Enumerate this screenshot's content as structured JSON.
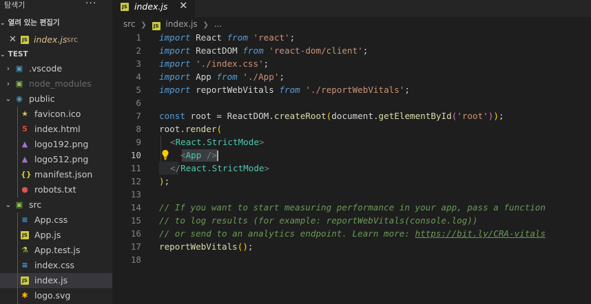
{
  "sidebar": {
    "title": "탐색기",
    "more": "···",
    "open_editors_label": "열려 있는 편집기",
    "open_editor": {
      "name": "index.js",
      "folder": "src"
    },
    "project_label": "TEST",
    "tree": [
      {
        "name": ".vscode",
        "type": "folder",
        "depth": 0,
        "state": "collapsed",
        "icon": "vscode-folder-icon",
        "color": "#519aba"
      },
      {
        "name": "node_modules",
        "type": "folder",
        "depth": 0,
        "state": "collapsed",
        "icon": "node-folder-icon",
        "color": "#8bc34a",
        "dimmed": true
      },
      {
        "name": "public",
        "type": "folder",
        "depth": 0,
        "state": "expanded",
        "icon": "public-folder-icon",
        "color": "#519aba"
      },
      {
        "name": "favicon.ico",
        "type": "file",
        "depth": 1,
        "icon": "star-icon",
        "color": "#cbcb41"
      },
      {
        "name": "index.html",
        "type": "file",
        "depth": 1,
        "icon": "html-icon",
        "color": "#e44d26"
      },
      {
        "name": "logo192.png",
        "type": "file",
        "depth": 1,
        "icon": "image-icon",
        "color": "#a074c4"
      },
      {
        "name": "logo512.png",
        "type": "file",
        "depth": 1,
        "icon": "image-icon",
        "color": "#a074c4"
      },
      {
        "name": "manifest.json",
        "type": "file",
        "depth": 1,
        "icon": "json-icon",
        "color": "#cbcb41"
      },
      {
        "name": "robots.txt",
        "type": "file",
        "depth": 1,
        "icon": "robot-icon",
        "color": "#e05252"
      },
      {
        "name": "src",
        "type": "folder",
        "depth": 0,
        "state": "expanded",
        "icon": "src-folder-icon",
        "color": "#8bc34a"
      },
      {
        "name": "App.css",
        "type": "file",
        "depth": 1,
        "icon": "css-icon",
        "color": "#42a5f5"
      },
      {
        "name": "App.js",
        "type": "file",
        "depth": 1,
        "icon": "js-icon",
        "color": "#cbcb41"
      },
      {
        "name": "App.test.js",
        "type": "file",
        "depth": 1,
        "icon": "test-icon",
        "color": "#cbcb41"
      },
      {
        "name": "index.css",
        "type": "file",
        "depth": 1,
        "icon": "css-icon",
        "color": "#42a5f5"
      },
      {
        "name": "index.js",
        "type": "file",
        "depth": 1,
        "icon": "js-icon",
        "color": "#cbcb41",
        "selected": true
      },
      {
        "name": "logo.svg",
        "type": "file",
        "depth": 1,
        "icon": "svg-icon",
        "color": "#ffb300"
      }
    ]
  },
  "tab": {
    "name": "index.js",
    "close": "✕"
  },
  "breadcrumb": {
    "folder": "src",
    "file": "index.js",
    "more": "..."
  },
  "editor": {
    "active_line": 10,
    "lines": [
      {
        "n": "1"
      },
      {
        "n": "2"
      },
      {
        "n": "3"
      },
      {
        "n": "4"
      },
      {
        "n": "5"
      },
      {
        "n": "6"
      },
      {
        "n": "7"
      },
      {
        "n": "8"
      },
      {
        "n": "9"
      },
      {
        "n": "10"
      },
      {
        "n": "11"
      },
      {
        "n": "12"
      },
      {
        "n": "13"
      },
      {
        "n": "14"
      },
      {
        "n": "15"
      },
      {
        "n": "16"
      },
      {
        "n": "17"
      },
      {
        "n": "18"
      }
    ]
  },
  "code": {
    "l1": [
      "import",
      " React ",
      "from",
      " 'react'",
      ";"
    ],
    "l2": [
      "import",
      " ReactDOM ",
      "from",
      " 'react-dom/client'",
      ";"
    ],
    "l3": [
      "import",
      " './index.css'",
      ";"
    ],
    "l4": [
      "import",
      " App ",
      "from",
      " './App'",
      ";"
    ],
    "l5": [
      "import",
      " reportWebVitals ",
      "from",
      " './reportWebVitals'",
      ";"
    ],
    "l7": [
      "const",
      " root ",
      "= ",
      "ReactDOM",
      ".",
      "createRoot",
      "(",
      "document",
      ".",
      "getElementById",
      "(",
      "'root'",
      ")",
      ")",
      ";"
    ],
    "l8": [
      "root",
      ".",
      "render",
      "("
    ],
    "l9": [
      "<",
      "React.StrictMode",
      ">"
    ],
    "l10": [
      "<",
      "App",
      " />"
    ],
    "l11": [
      "</",
      "React.StrictMode",
      ">"
    ],
    "l12": [
      ")",
      ";"
    ],
    "l14": "// If you want to start measuring performance in your app, pass a function",
    "l15": "// to log results (for example: reportWebVitals(console.log))",
    "l16_a": "// or send to an analytics endpoint. Learn more: ",
    "l16_b": "https://bit.ly/CRA-vitals",
    "l17": [
      "reportWebVitals",
      "(",
      ")",
      ";"
    ]
  }
}
